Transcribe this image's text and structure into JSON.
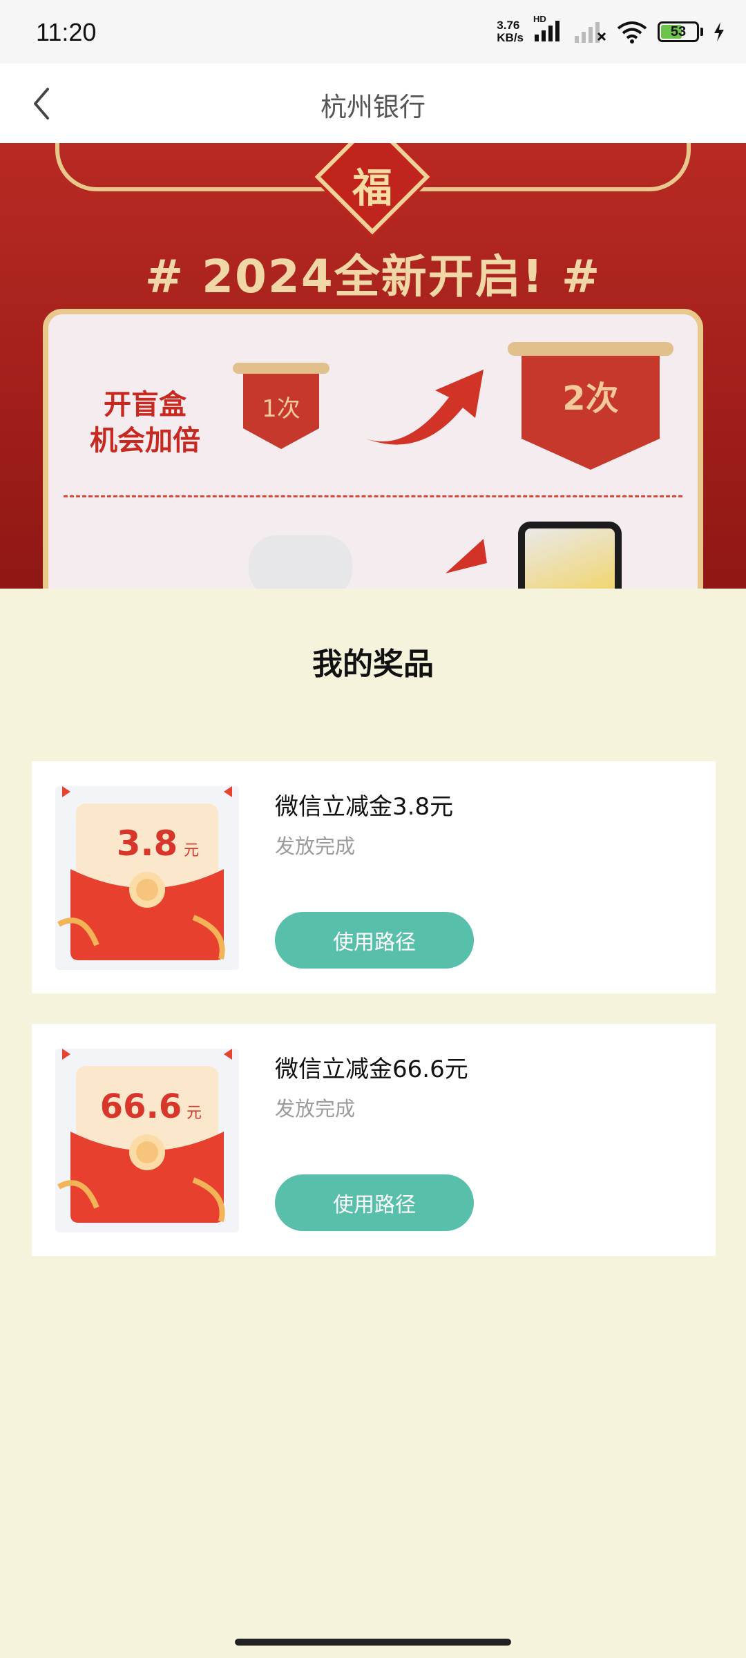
{
  "status_bar": {
    "time": "11:20",
    "net_speed_value": "3.76",
    "net_speed_unit": "KB/s",
    "net_type": "HD",
    "battery_level": "53",
    "icons": [
      "signal-icon",
      "no-signal-icon",
      "wifi-icon",
      "battery-icon",
      "charging-icon"
    ]
  },
  "nav": {
    "title": "杭州银行",
    "back_icon": "chevron-left-icon"
  },
  "banner": {
    "fu_char": "福",
    "headline": "# 2024全新开启! #",
    "double_label_line1": "开盲盒",
    "double_label_line2": "机会加倍",
    "count_before": "1次",
    "count_after": "2次"
  },
  "prizes": {
    "title": "我的奖品",
    "items": [
      {
        "amount": "3.8",
        "unit": "元",
        "name": "微信立减金3.8元",
        "status": "发放完成",
        "button_label": "使用路径"
      },
      {
        "amount": "66.6",
        "unit": "元",
        "name": "微信立减金66.6元",
        "status": "发放完成",
        "button_label": "使用路径"
      }
    ]
  },
  "colors": {
    "page_bg": "#f6f3dc",
    "button_bg": "#58bfaa",
    "banner_red": "#b82a23",
    "envelope_red": "#e8402e",
    "status_gray": "#9b9b9b"
  }
}
